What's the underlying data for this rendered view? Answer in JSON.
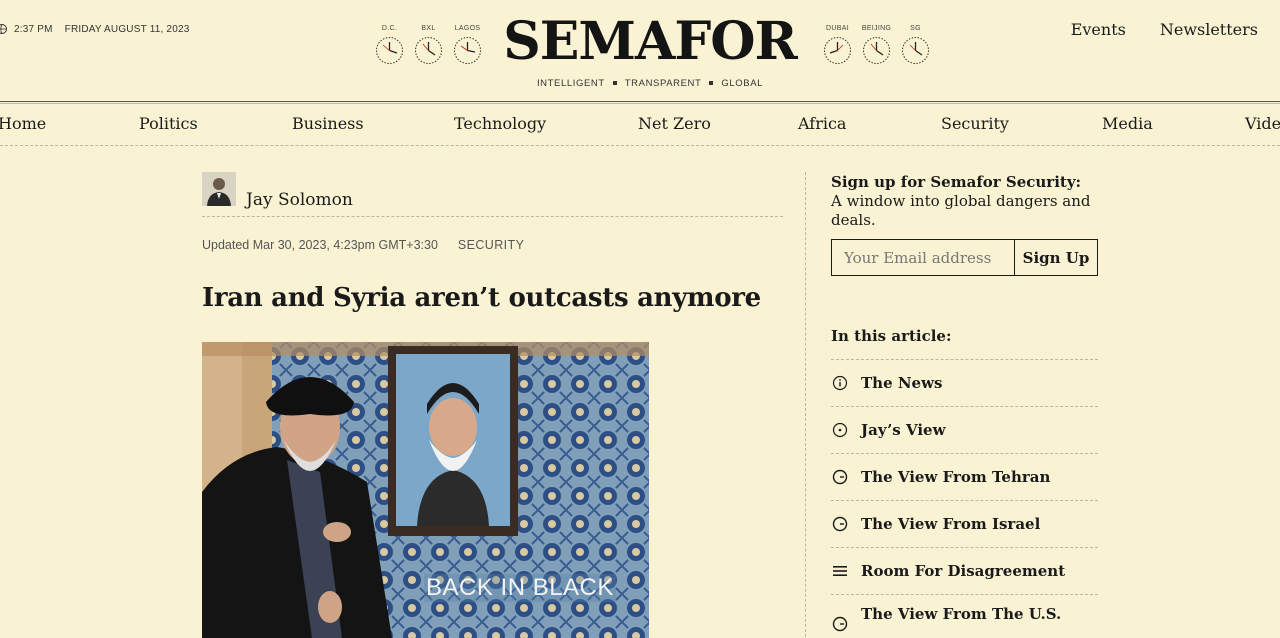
{
  "header": {
    "time": "2:37 PM",
    "date": "FRIDAY AUGUST 11, 2023",
    "logo": "SEMAFOR",
    "tagline": [
      "INTELLIGENT",
      "TRANSPARENT",
      "GLOBAL"
    ],
    "clocks_left": [
      "D.C.",
      "BXL",
      "LAGOS"
    ],
    "clocks_right": [
      "DUBAI",
      "BEIJING",
      "SG"
    ],
    "links": {
      "events": "Events",
      "newsletters": "Newsletters"
    }
  },
  "nav": {
    "items": [
      "Home",
      "Politics",
      "Business",
      "Technology",
      "Net Zero",
      "Africa",
      "Security",
      "Media",
      "Video"
    ]
  },
  "article": {
    "author": "Jay Solomon",
    "updated": "Updated Mar 30, 2023, 4:23pm GMT+3:30",
    "section": "SECURITY",
    "headline": "Iran and Syria aren’t outcasts anymore",
    "image_caption": "BACK IN BLACK"
  },
  "sidebar": {
    "signup_bold": "Sign up for Semafor Security:",
    "signup_text": " A window into global dangers and deals.",
    "email_placeholder": "Your Email address",
    "signup_button": "Sign Up",
    "toc_title": "In this article:",
    "toc": [
      {
        "label": "The News",
        "icon": "info-icon"
      },
      {
        "label": "Jay’s View",
        "icon": "circle-dot-icon"
      },
      {
        "label": "The View From Tehran",
        "icon": "clock-icon"
      },
      {
        "label": "The View From Israel",
        "icon": "clock-icon"
      },
      {
        "label": "Room For Disagreement",
        "icon": "lines-icon"
      },
      {
        "label": "The View From The U.S.",
        "icon": "clock-icon"
      }
    ]
  }
}
